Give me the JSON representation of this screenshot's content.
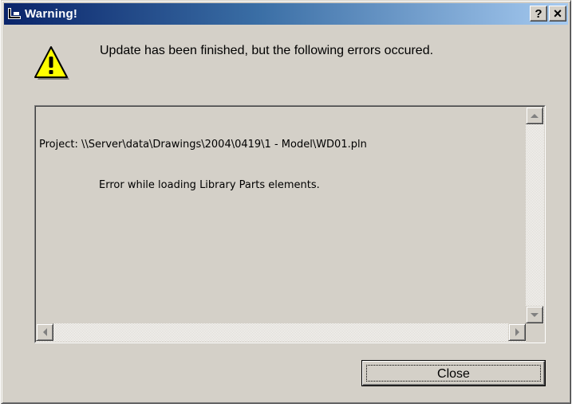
{
  "window": {
    "title": "Warning!",
    "help_button": "?",
    "close_button": "×"
  },
  "message": "Update has been finished, but the following errors occured.",
  "errors": {
    "project_line": "Project: \\\\Server\\data\\Drawings\\2004\\0419\\1 - Model\\WD01.pln",
    "error_line": "Error while loading Library Parts elements."
  },
  "buttons": {
    "close_label": "Close"
  },
  "colors": {
    "dialog_face": "#d4d0c8",
    "title_start": "#0a246a",
    "title_end": "#a6caf0",
    "warning_yellow": "#ffff00"
  },
  "icons": {
    "title": "app-icon",
    "message": "warning-icon"
  }
}
